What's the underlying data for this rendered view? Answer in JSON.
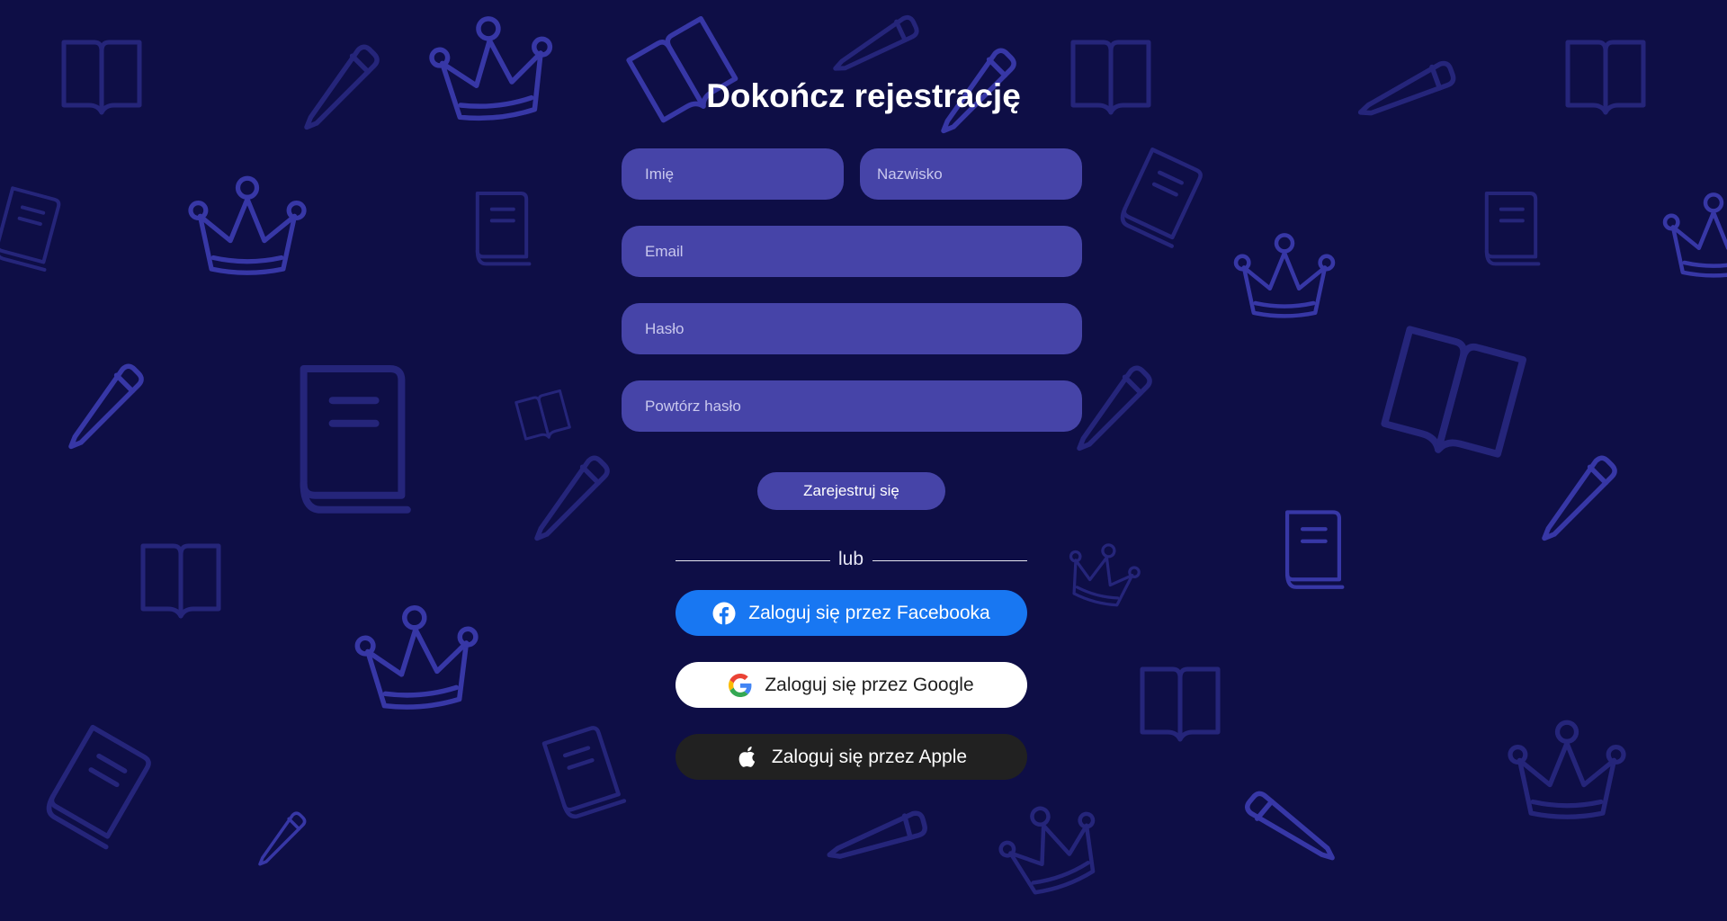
{
  "form": {
    "title": "Dokończ rejestrację",
    "first_name_placeholder": "Imię",
    "last_name_placeholder": "Nazwisko",
    "email_placeholder": "Email",
    "password_placeholder": "Hasło",
    "repeat_password_placeholder": "Powtórz hasło",
    "submit_label": "Zarejestruj się"
  },
  "divider": {
    "text": "lub"
  },
  "social": {
    "facebook_label": "Zaloguj się przez Facebooka",
    "google_label": "Zaloguj się przez Google",
    "apple_label": "Zaloguj się przez Apple"
  },
  "background": {
    "icons": [
      "book-open-icon",
      "pencil-icon",
      "crown-icon",
      "book-icon"
    ]
  },
  "colors": {
    "background": "#0e0e46",
    "field": "#4644a8",
    "icon_pattern": "#3737a6",
    "facebook": "#1877f2",
    "google": "#ffffff",
    "apple": "#212121"
  }
}
